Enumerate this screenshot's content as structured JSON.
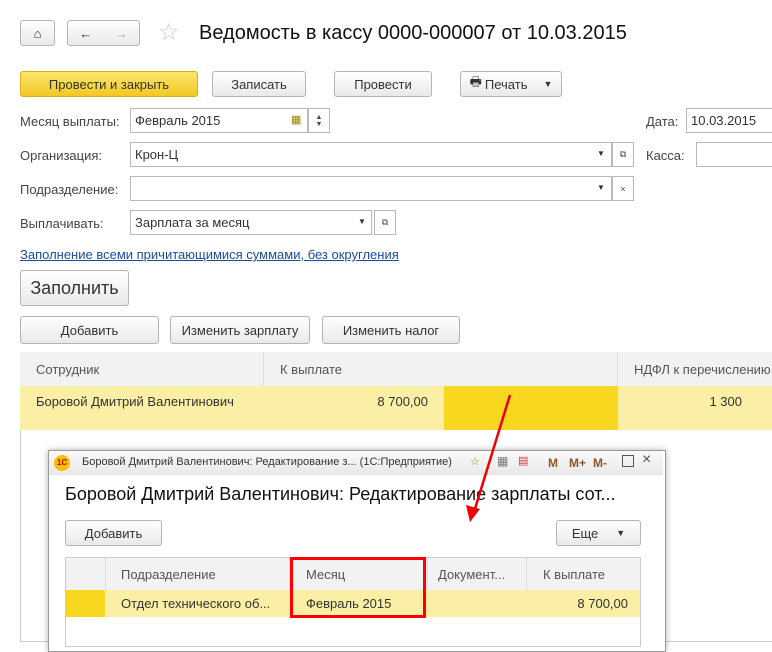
{
  "header": {
    "title": "Ведомость в кассу 0000-000007 от 10.03.2015"
  },
  "toolbar": {
    "post_close": "Провести и закрыть",
    "save": "Записать",
    "post": "Провести",
    "print": "Печать"
  },
  "form": {
    "month_label": "Месяц выплаты:",
    "month_value": "Февраль 2015",
    "date_label": "Дата:",
    "date_value": "10.03.2015",
    "org_label": "Организация:",
    "org_value": "Крон-Ц",
    "cash_label": "Касса:",
    "dept_label": "Подразделение:",
    "dept_value": "",
    "pay_label": "Выплачивать:",
    "pay_value": "Зарплата за месяц",
    "fill_link": "Заполнение всеми причитающимися суммами, без округления",
    "fill_button": "Заполнить"
  },
  "table_toolbar": {
    "add": "Добавить",
    "edit_salary": "Изменить зарплату",
    "edit_tax": "Изменить налог"
  },
  "table": {
    "columns": [
      "Сотрудник",
      "К выплате",
      "НДФЛ к перечислению"
    ],
    "rows": [
      {
        "employee": "Боровой Дмитрий Валентинович",
        "amount": "8 700,00",
        "tax": "1 300"
      }
    ]
  },
  "dialog": {
    "window_title": "Боровой Дмитрий Валентинович: Редактирование з...  (1С:Предприятие)",
    "heading": "Боровой Дмитрий Валентинович: Редактирование зарплаты сот...",
    "add": "Добавить",
    "more": "Еще",
    "columns": [
      "Подразделение",
      "Месяц",
      "Документ...",
      "К выплате"
    ],
    "rows": [
      {
        "dept": "Отдел технического об...",
        "month": "Февраль 2015",
        "doc": "",
        "amount": "8 700,00"
      }
    ],
    "title_icons": [
      "M",
      "M+",
      "M-"
    ]
  },
  "colors": {
    "accent": "#f3c823",
    "row": "#fbefa5",
    "highlight": "#ff0000"
  }
}
